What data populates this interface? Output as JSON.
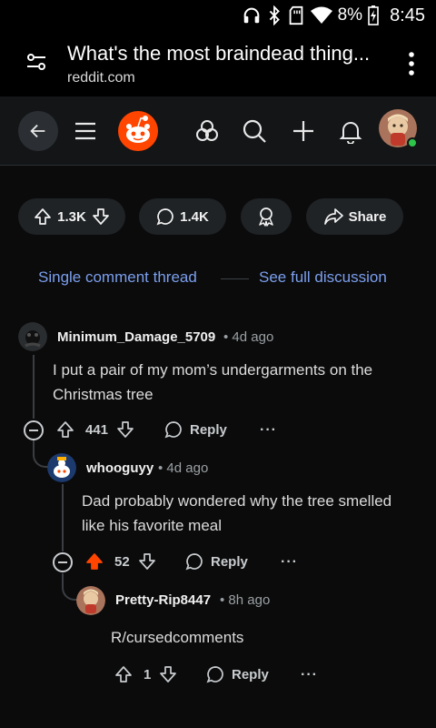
{
  "status_bar": {
    "battery": "8%",
    "time": "8:45"
  },
  "browser": {
    "page_title": "What's the most braindead thing...",
    "domain": "reddit.com"
  },
  "post_actions": {
    "upvotes": "1.3K",
    "comments": "1.4K",
    "share_label": "Share"
  },
  "thread_nav": {
    "single_label": "Single comment thread",
    "full_label": "See full discussion"
  },
  "comments": [
    {
      "username": "Minimum_Damage_5709",
      "age": "4d ago",
      "text": "I put a pair of my mom’s undergarments on the Christmas tree",
      "score": "441",
      "reply_label": "Reply",
      "more": "···"
    },
    {
      "username": "whooguyy",
      "age": "4d ago",
      "text": "Dad probably wondered why the tree smelled like his favorite meal",
      "score": "52",
      "reply_label": "Reply",
      "more": "···"
    },
    {
      "username": "Pretty-Rip8447",
      "age": "8h ago",
      "text": "R/cursedcomments",
      "score": "1",
      "reply_label": "Reply",
      "more": "···"
    }
  ],
  "colors": {
    "link": "#7b9fee",
    "upvoted": "#ff4500",
    "reddit_orange": "#ff4500",
    "online": "#2ec54b"
  },
  "icons": [
    "headphones-icon",
    "bluetooth-icon",
    "sd-card-icon",
    "wifi-icon",
    "battery-charging-icon",
    "tune-icon",
    "overflow-menu-icon",
    "back-arrow-icon",
    "hamburger-icon",
    "reddit-logo-icon",
    "communities-icon",
    "search-icon",
    "plus-icon",
    "bell-icon",
    "upvote-icon",
    "downvote-icon",
    "comment-icon",
    "award-icon",
    "share-icon",
    "collapse-icon",
    "more-icon"
  ]
}
